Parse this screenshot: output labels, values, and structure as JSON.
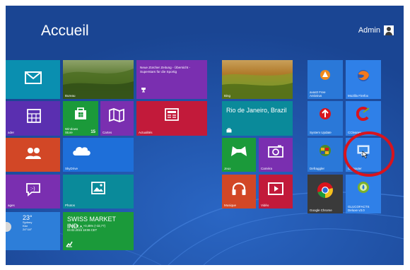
{
  "start_screen": {
    "title": "Accueil",
    "user_name": "Admin"
  },
  "tiles": {
    "mail": {
      "label": ""
    },
    "photo_landscape": {
      "label": "Bureau"
    },
    "news": {
      "text": "Neue Zürcher Zeitung - Übersicht - Superstars für die Sportig",
      "label": ""
    },
    "calendar": {
      "label": "ader"
    },
    "windows_store": {
      "label": "Windows Store",
      "badge": "15"
    },
    "maps": {
      "label": "Cartes"
    },
    "actualites": {
      "label": "Actualités"
    },
    "people": {
      "label": ""
    },
    "skydrive": {
      "label": "SkyDrive"
    },
    "messaging": {
      "label": "ages"
    },
    "photos": {
      "label": "Photos"
    },
    "weather": {
      "temp": "23°",
      "city": "Sydney",
      "condition": "Klar",
      "range": "24°/18°"
    },
    "finance": {
      "title": "SWISS MARKET IND...",
      "values": "7.795,49 ▲ +0,45% (+32,77)",
      "date": "03.02.2015 18:06 CET"
    },
    "bing": {
      "label": "Bing"
    },
    "travel": {
      "title": "Rio de Janeiro, Brazil"
    },
    "games": {
      "label": "Jeux"
    },
    "camera": {
      "label": "Caméra"
    },
    "music": {
      "label": "Musique"
    },
    "video": {
      "label": "Vidéo"
    },
    "avast": {
      "label": "avast! Free Antivirus"
    },
    "firefox": {
      "label": "Mozilla Firefox"
    },
    "system_update": {
      "label": "System Update"
    },
    "ccleaner": {
      "label": "CCleaner"
    },
    "defraggler": {
      "label": "Defraggler"
    },
    "computer": {
      "label": "Computer"
    },
    "chrome": {
      "label": "Google Chrome"
    },
    "glucoracts": {
      "label": "GLUCOFACTS Deluxe v3.0"
    }
  },
  "colors": {
    "background": "#1c4fa0",
    "blue_tile": "#2a78d8",
    "green_tile": "#1b9a3a",
    "orange_tile": "#d24726",
    "purple_tile": "#7a2fb0",
    "crimson_tile": "#c21a3a",
    "teal_tile": "#0a8a9a",
    "light_blue_tile": "#2f80e8",
    "highlight": "#d8141d"
  }
}
